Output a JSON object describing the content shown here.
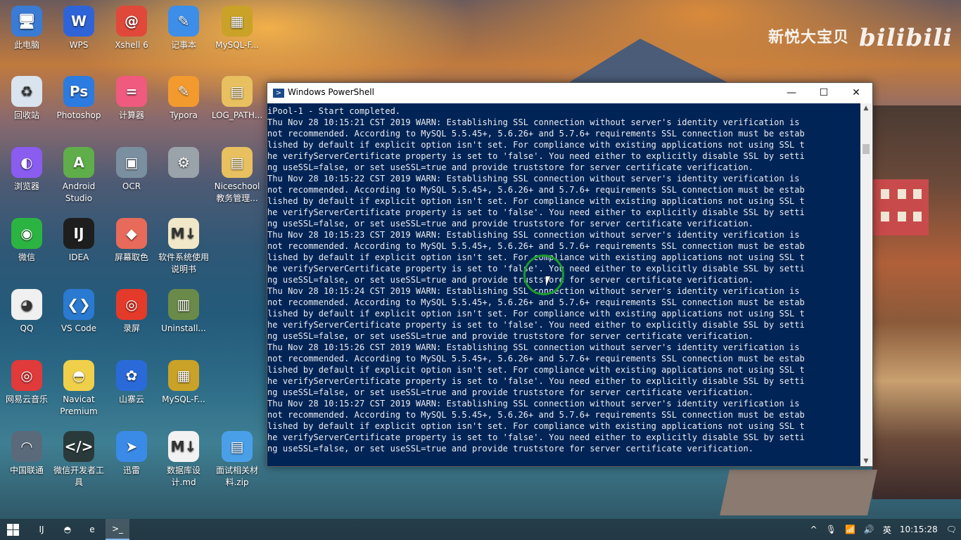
{
  "watermark": {
    "text": "新悦大宝贝",
    "brand": "bilibili"
  },
  "desktop_icons": [
    {
      "label": "此电脑",
      "glyph": "🖥",
      "color": "#3a7bd5",
      "col": 0,
      "row": 0
    },
    {
      "label": "WPS",
      "glyph": "W",
      "color": "#2f64d8",
      "col": 1,
      "row": 0
    },
    {
      "label": "Xshell 6",
      "glyph": "@",
      "color": "#e0483a",
      "col": 2,
      "row": 0
    },
    {
      "label": "记事本",
      "glyph": "✎",
      "color": "#3d8ee8",
      "col": 3,
      "row": 0
    },
    {
      "label": "MySQL-F...",
      "glyph": "▦",
      "color": "#c9a227",
      "col": 4,
      "row": 0
    },
    {
      "label": "回收站",
      "glyph": "♻",
      "color": "#d9e4ee",
      "col": 0,
      "row": 1
    },
    {
      "label": "Photoshop",
      "glyph": "Ps",
      "color": "#2b7be0",
      "col": 1,
      "row": 1
    },
    {
      "label": "计算器",
      "glyph": "=",
      "color": "#f05a7e",
      "col": 2,
      "row": 1
    },
    {
      "label": "Typora",
      "glyph": "✎",
      "color": "#f29a2e",
      "col": 3,
      "row": 1
    },
    {
      "label": "LOG_PATH...",
      "glyph": "▤",
      "color": "#e8c060",
      "col": 4,
      "row": 1
    },
    {
      "label": "浏览器",
      "glyph": "◐",
      "color": "#8a5cf0",
      "col": 0,
      "row": 2
    },
    {
      "label": "Android Studio",
      "glyph": "A",
      "color": "#5fae4a",
      "col": 1,
      "row": 2
    },
    {
      "label": "OCR",
      "glyph": "▣",
      "color": "#7a8fa0",
      "col": 2,
      "row": 2
    },
    {
      "label": "",
      "glyph": "⚙",
      "color": "#9aa3aa",
      "col": 3,
      "row": 2
    },
    {
      "label": "Niceschool 教务管理...",
      "glyph": "▤",
      "color": "#e8c060",
      "col": 4,
      "row": 2
    },
    {
      "label": "微信",
      "glyph": "◉",
      "color": "#2bb441",
      "col": 0,
      "row": 3
    },
    {
      "label": "IDEA",
      "glyph": "IJ",
      "color": "#1e1e1e",
      "col": 1,
      "row": 3
    },
    {
      "label": "屏幕取色",
      "glyph": "◆",
      "color": "#e86a5a",
      "col": 2,
      "row": 3
    },
    {
      "label": "软件系统使用说明书",
      "glyph": "M↓",
      "color": "#f0e8c8",
      "col": 3,
      "row": 3
    },
    {
      "label": "QQ",
      "glyph": "◕",
      "color": "#f0f0f0",
      "col": 0,
      "row": 4
    },
    {
      "label": "VS Code",
      "glyph": "❮❯",
      "color": "#2a7ad2",
      "col": 1,
      "row": 4
    },
    {
      "label": "录屏",
      "glyph": "◎",
      "color": "#e43a2a",
      "col": 2,
      "row": 4
    },
    {
      "label": "Uninstall...",
      "glyph": "▥",
      "color": "#6a8a4a",
      "col": 3,
      "row": 4
    },
    {
      "label": "网易云音乐",
      "glyph": "◎",
      "color": "#e03a3a",
      "col": 0,
      "row": 5
    },
    {
      "label": "Navicat Premium",
      "glyph": "◓",
      "color": "#f0d04a",
      "col": 1,
      "row": 5
    },
    {
      "label": "山寨云",
      "glyph": "✿",
      "color": "#2a6ad8",
      "col": 2,
      "row": 5
    },
    {
      "label": "MySQL-F...",
      "glyph": "▦",
      "color": "#c9a227",
      "col": 3,
      "row": 5
    },
    {
      "label": "中国联通",
      "glyph": "◠",
      "color": "#5a6a7a",
      "col": 0,
      "row": 6
    },
    {
      "label": "微信开发者工具",
      "glyph": "</>",
      "color": "#2a3a3a",
      "col": 1,
      "row": 6
    },
    {
      "label": "迅雷",
      "glyph": "➤",
      "color": "#3a8ae8",
      "col": 2,
      "row": 6
    },
    {
      "label": "数据库设计.md",
      "glyph": "M↓",
      "color": "#f2f2f2",
      "col": 3,
      "row": 6
    },
    {
      "label": "面试相关材料.zip",
      "glyph": "▤",
      "color": "#4aa0e8",
      "col": 4,
      "row": 6
    }
  ],
  "powershell": {
    "title": "Windows PowerShell",
    "lines": [
      "iPool-1 - Start completed.",
      "Thu Nov 28 10:15:21 CST 2019 WARN: Establishing SSL connection without server's identity verification is",
      "not recommended. According to MySQL 5.5.45+, 5.6.26+ and 5.7.6+ requirements SSL connection must be estab",
      "lished by default if explicit option isn't set. For compliance with existing applications not using SSL t",
      "he verifyServerCertificate property is set to 'false'. You need either to explicitly disable SSL by setti",
      "ng useSSL=false, or set useSSL=true and provide truststore for server certificate verification.",
      "Thu Nov 28 10:15:22 CST 2019 WARN: Establishing SSL connection without server's identity verification is",
      "not recommended. According to MySQL 5.5.45+, 5.6.26+ and 5.7.6+ requirements SSL connection must be estab",
      "lished by default if explicit option isn't set. For compliance with existing applications not using SSL t",
      "he verifyServerCertificate property is set to 'false'. You need either to explicitly disable SSL by setti",
      "ng useSSL=false, or set useSSL=true and provide truststore for server certificate verification.",
      "Thu Nov 28 10:15:23 CST 2019 WARN: Establishing SSL connection without server's identity verification is",
      "not recommended. According to MySQL 5.5.45+, 5.6.26+ and 5.7.6+ requirements SSL connection must be estab",
      "lished by default if explicit option isn't set. For compliance with existing applications not using SSL t",
      "he verifyServerCertificate property is set to 'false'. You need either to explicitly disable SSL by setti",
      "ng useSSL=false, or set useSSL=true and provide truststore for server certificate verification.",
      "Thu Nov 28 10:15:24 CST 2019 WARN: Establishing SSL connection without server's identity verification is",
      "not recommended. According to MySQL 5.5.45+, 5.6.26+ and 5.7.6+ requirements SSL connection must be estab",
      "lished by default if explicit option isn't set. For compliance with existing applications not using SSL t",
      "he verifyServerCertificate property is set to 'false'. You need either to explicitly disable SSL by setti",
      "ng useSSL=false, or set useSSL=true and provide truststore for server certificate verification.",
      "Thu Nov 28 10:15:26 CST 2019 WARN: Establishing SSL connection without server's identity verification is",
      "not recommended. According to MySQL 5.5.45+, 5.6.26+ and 5.7.6+ requirements SSL connection must be estab",
      "lished by default if explicit option isn't set. For compliance with existing applications not using SSL t",
      "he verifyServerCertificate property is set to 'false'. You need either to explicitly disable SSL by setti",
      "ng useSSL=false, or set useSSL=true and provide truststore for server certificate verification.",
      "Thu Nov 28 10:15:27 CST 2019 WARN: Establishing SSL connection without server's identity verification is",
      "not recommended. According to MySQL 5.5.45+, 5.6.26+ and 5.7.6+ requirements SSL connection must be estab",
      "lished by default if explicit option isn't set. For compliance with existing applications not using SSL t",
      "he verifyServerCertificate property is set to 'false'. You need either to explicitly disable SSL by setti",
      "ng useSSL=false, or set useSSL=true and provide truststore for server certificate verification."
    ],
    "bg_color": "#012456",
    "text_color": "#eeedf0"
  },
  "window_controls": {
    "minimize": "—",
    "maximize": "☐",
    "close": "✕"
  },
  "taskbar": {
    "apps": [
      {
        "name": "intellij-idea-taskbar",
        "glyph": "IJ",
        "active": false
      },
      {
        "name": "navicat-taskbar",
        "glyph": "◓",
        "active": false
      },
      {
        "name": "edge-taskbar",
        "glyph": "e",
        "active": false
      },
      {
        "name": "powershell-taskbar",
        "glyph": ">_",
        "active": true
      }
    ],
    "tray": {
      "chevron": "^",
      "ime": "英",
      "time": "10:15:28"
    }
  }
}
